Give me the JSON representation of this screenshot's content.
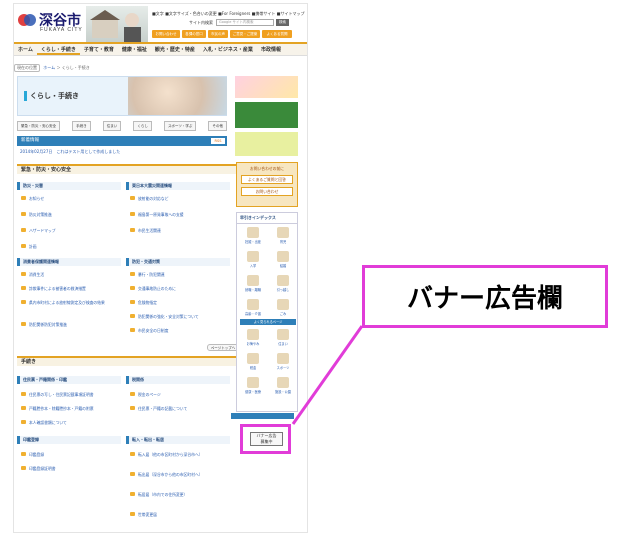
{
  "header": {
    "logo_name": "深谷市",
    "logo_sub": "FUKAYA CITY",
    "links": [
      "■文字",
      "■文字サイズ・色合いの変更",
      "■For Foreigners",
      "■携帯サイト",
      "■サイトマップ"
    ],
    "site_search_label": "サイト内検索",
    "search_placeholder": "Google サイト内検索",
    "search_button": "検索",
    "util_buttons": [
      "お問い合わせ",
      "各課の窓口",
      "市民の声",
      "ご意見・ご提案",
      "よくある質問"
    ]
  },
  "gnav": [
    "ホーム",
    "くらし・手続き",
    "子育て・教育",
    "健康・福祉",
    "観光・歴史・特産",
    "入札・ビジネス・産業",
    "市政情報"
  ],
  "breadcrumb": {
    "here_label": "現在の位置",
    "home": "ホーム",
    "sep": "＞",
    "current": "くらし・手続き"
  },
  "banner_title": "くらし・手続き",
  "tabs": [
    "緊急・防災・安心安全",
    "手続き",
    "住まい",
    "くらし",
    "スポーツ・学ぶ",
    "その他"
  ],
  "news": {
    "title": "新着情報",
    "rss": "RSS",
    "item": "2014年02月27日　これはテスト用として作成しました"
  },
  "sections": {
    "emergency": "緊急・防災・安心安全",
    "procedures": "手続き"
  },
  "boxes": {
    "disaster": {
      "title": "防災・災害",
      "items": [
        "お知らせ",
        "防災対策推進",
        "ハザードマップ",
        "計画"
      ]
    },
    "quake": {
      "title": "東日本大震災関連情報",
      "items": [
        "放射能の対応など",
        "福島第一原発事故への支援",
        "市民生活関連"
      ]
    },
    "fire": {
      "title": "消費者保護関連情報",
      "items": [
        "消費生活",
        "詐欺事件による被害者の救済措置",
        "県内市町村による放射線測定及び検査の結果",
        "防犯関係防犯対策推進"
      ]
    },
    "safety": {
      "title": "防犯・交通対策",
      "items": [
        "暴行・防犯関連",
        "交通事故防止のために",
        "危険物指定",
        "防犯関係の強化・安全対策について",
        "市民安全の日制度"
      ]
    },
    "register": {
      "title": "住民票・戸籍関係・印鑑",
      "items": [
        "住民票の写し・住民票記載事項証明書",
        "戸籍謄抄本・除籍謄抄本・戸籍の附票",
        "本人確認書類について"
      ]
    },
    "tax": {
      "title": "税関係",
      "items": [
        "税金のページ",
        "住民票・戸籍の記載について"
      ]
    },
    "stamp": {
      "title": "印鑑登録",
      "items": [
        "印鑑登録",
        "印鑑登録証明書"
      ]
    },
    "move": {
      "title": "転入・転出・転居",
      "items": [
        "転入届（他の市区町村から深谷市へ）",
        "転出届（深谷市から他の市区町村へ）",
        "転居届（市内での住所変更）",
        "世帯変更届"
      ]
    }
  },
  "pagetop": "ページトップへ",
  "right": {
    "qa_title": "お問い合わせの前に",
    "qa_buttons": [
      "よくあるご質問と回答",
      "お問い合わせ"
    ],
    "index_title": "早引きインデックス",
    "icons": [
      "妊娠・出産",
      "育児",
      "入学",
      "結婚",
      "就職・離職",
      "引っ越し",
      "高齢・介護",
      "ごみ",
      "お悔やみ",
      "住まい",
      "税金",
      "スポーツ",
      "健康・医療",
      "施設・公園",
      "ゴミ",
      "災害"
    ],
    "sub_title": "よく見られるページ"
  },
  "banner_slot": {
    "line1": "バナー広告",
    "line2": "募集中"
  },
  "callout_text": "バナー広告欄",
  "accent": "#e13cd8"
}
